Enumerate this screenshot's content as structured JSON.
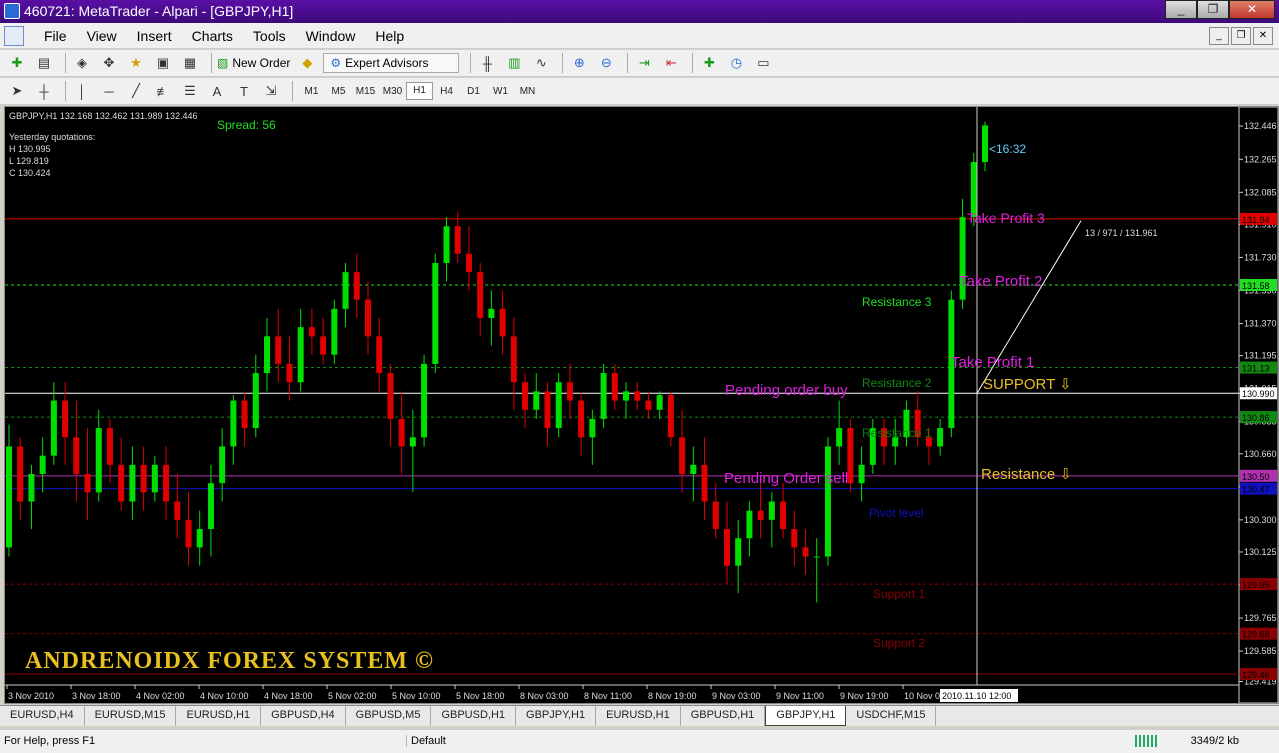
{
  "window": {
    "title": "460721: MetaTrader - Alpari - [GBPJPY,H1]",
    "controls": [
      "_",
      "❐",
      "✕"
    ]
  },
  "menu": [
    "File",
    "View",
    "Insert",
    "Charts",
    "Tools",
    "Window",
    "Help"
  ],
  "toolbar": {
    "new_order": "New Order",
    "expert_advisors": "Expert Advisors"
  },
  "timeframes": [
    "M1",
    "M5",
    "M15",
    "M30",
    "H1",
    "H4",
    "D1",
    "W1",
    "MN"
  ],
  "active_timeframe": "H1",
  "chart": {
    "symbol_info": "GBPJPY,H1  132.168 132.462 131.989 132.446",
    "spread": "Spread: 56",
    "yesterday_label": "Yesterday quotations:",
    "yesterday": [
      "H 130.995",
      "L 129.819",
      "C 130.424"
    ],
    "timer": "<16:32",
    "trendline_label": "13 / 971 / 131.961",
    "watermark": "ANDRENOIDX FOREX SYSTEM    ©",
    "crosshair_time": "2010.11.10 12:00",
    "colors": {
      "bull": "#00e000",
      "bear": "#e00000",
      "resistance": "#22dd22",
      "support": "#8b0000",
      "pivot": "#1010c0",
      "magenta": "#e020e0",
      "gold": "#e8c020"
    }
  },
  "chart_data": {
    "type": "candlestick",
    "symbol": "GBPJPY",
    "timeframe": "H1",
    "y_ticks": [
      "132.446",
      "132.265",
      "132.085",
      "131.910",
      "131.730",
      "131.550",
      "131.370",
      "131.195",
      "131.015",
      "130.990",
      "130.835",
      "130.660",
      "130.480",
      "130.300",
      "130.125",
      "129.945",
      "129.765",
      "129.585",
      "129.419"
    ],
    "x_ticks": [
      "3 Nov 2010",
      "3 Nov 18:00",
      "4 Nov 02:00",
      "4 Nov 10:00",
      "4 Nov 18:00",
      "5 Nov 02:00",
      "5 Nov 10:00",
      "5 Nov 18:00",
      "8 Nov 03:00",
      "8 Nov 11:00",
      "8 Nov 19:00",
      "9 Nov 03:00",
      "9 Nov 11:00",
      "9 Nov 19:00",
      "10 Nov 0"
    ],
    "ylim": [
      129.4,
      132.55
    ],
    "levels": [
      {
        "name": "Take Profit 3",
        "price": 131.94,
        "price_label": "131.94",
        "color": "#e00000",
        "label_color": "#e020e0"
      },
      {
        "name": "Resistance 3",
        "price": 131.58,
        "price_label": "131.58",
        "color": "#22dd22",
        "label_color": "#22dd22"
      },
      {
        "name": "Resistance 2",
        "price": 131.13,
        "price_label": "131.13",
        "color": "#118811",
        "label_color": "#118811"
      },
      {
        "name": "Resistance 1",
        "price": 130.86,
        "price_label": "130.86",
        "color": "#118811",
        "label_color": "#117711"
      },
      {
        "name": "Pivot level",
        "price": 130.47,
        "price_label": "130.47",
        "color": "#1010c0",
        "label_color": "#1010c0"
      },
      {
        "name": "Support 1",
        "price": 129.95,
        "price_label": "129.95",
        "color": "#8b0000",
        "label_color": "#8b0000"
      },
      {
        "name": "Support 2",
        "price": 129.68,
        "price_label": "129.68",
        "color": "#8b0000",
        "label_color": "#8b0000"
      },
      {
        "name": "",
        "price": 129.46,
        "price_label": "129.46",
        "color": "#8b0000",
        "label_color": "#8b0000"
      },
      {
        "name": "Pending order buy",
        "price": 130.99,
        "price_label": "130.990",
        "color": "#ffffff",
        "label_color": "#e020e0"
      },
      {
        "name": "Pending Order sell",
        "price": 130.54,
        "price_label": "130.50",
        "color": "#b030b0",
        "label_color": "#e020e0"
      }
    ],
    "annotations": [
      {
        "text": "Take Profit 2",
        "color": "#e020e0"
      },
      {
        "text": "Take Profit 1",
        "color": "#e020e0"
      },
      {
        "text": "SUPPORT ⇩",
        "color": "#e8c020"
      },
      {
        "text": "Resistance ⇩",
        "color": "#e8c020"
      }
    ],
    "candles": [
      [
        130.15,
        130.82,
        130.1,
        130.7
      ],
      [
        130.7,
        130.75,
        130.3,
        130.4
      ],
      [
        130.4,
        130.6,
        130.25,
        130.55
      ],
      [
        130.55,
        130.75,
        130.45,
        130.65
      ],
      [
        130.65,
        131.05,
        130.6,
        130.95
      ],
      [
        130.95,
        131.05,
        130.6,
        130.75
      ],
      [
        130.75,
        130.95,
        130.4,
        130.55
      ],
      [
        130.55,
        130.8,
        130.3,
        130.45
      ],
      [
        130.45,
        130.9,
        130.4,
        130.8
      ],
      [
        130.8,
        130.85,
        130.5,
        130.6
      ],
      [
        130.6,
        130.75,
        130.35,
        130.4
      ],
      [
        130.4,
        130.7,
        130.3,
        130.6
      ],
      [
        130.6,
        130.7,
        130.35,
        130.45
      ],
      [
        130.45,
        130.65,
        130.4,
        130.6
      ],
      [
        130.6,
        130.7,
        130.3,
        130.4
      ],
      [
        130.4,
        130.55,
        130.2,
        130.3
      ],
      [
        130.3,
        130.45,
        130.05,
        130.15
      ],
      [
        130.15,
        130.35,
        130.05,
        130.25
      ],
      [
        130.25,
        130.6,
        130.1,
        130.5
      ],
      [
        130.5,
        130.8,
        130.4,
        130.7
      ],
      [
        130.7,
        130.98,
        130.6,
        130.95
      ],
      [
        130.95,
        131.0,
        130.7,
        130.8
      ],
      [
        130.8,
        131.2,
        130.75,
        131.1
      ],
      [
        131.1,
        131.4,
        131.0,
        131.3
      ],
      [
        131.3,
        131.45,
        131.05,
        131.15
      ],
      [
        131.15,
        131.3,
        130.95,
        131.05
      ],
      [
        131.05,
        131.45,
        131.0,
        131.35
      ],
      [
        131.35,
        131.45,
        131.2,
        131.3
      ],
      [
        131.3,
        131.4,
        131.15,
        131.2
      ],
      [
        131.2,
        131.5,
        131.15,
        131.45
      ],
      [
        131.45,
        131.7,
        131.35,
        131.65
      ],
      [
        131.65,
        131.75,
        131.4,
        131.5
      ],
      [
        131.5,
        131.6,
        131.2,
        131.3
      ],
      [
        131.3,
        131.4,
        131.0,
        131.1
      ],
      [
        131.1,
        131.15,
        130.7,
        130.85
      ],
      [
        130.85,
        131.0,
        130.55,
        130.7
      ],
      [
        130.7,
        130.9,
        130.45,
        130.75
      ],
      [
        130.75,
        131.2,
        130.7,
        131.15
      ],
      [
        131.15,
        131.75,
        131.1,
        131.7
      ],
      [
        131.7,
        131.95,
        131.6,
        131.9
      ],
      [
        131.9,
        131.98,
        131.7,
        131.75
      ],
      [
        131.75,
        131.9,
        131.55,
        131.65
      ],
      [
        131.65,
        131.7,
        131.3,
        131.4
      ],
      [
        131.4,
        131.55,
        131.25,
        131.45
      ],
      [
        131.45,
        131.55,
        131.2,
        131.3
      ],
      [
        131.3,
        131.4,
        130.9,
        131.05
      ],
      [
        131.05,
        131.1,
        130.8,
        130.9
      ],
      [
        130.9,
        131.1,
        130.85,
        131.0
      ],
      [
        131.0,
        131.05,
        130.7,
        130.8
      ],
      [
        130.8,
        131.1,
        130.75,
        131.05
      ],
      [
        131.05,
        131.15,
        130.85,
        130.95
      ],
      [
        130.95,
        131.0,
        130.65,
        130.75
      ],
      [
        130.75,
        130.9,
        130.6,
        130.85
      ],
      [
        130.85,
        131.15,
        130.8,
        131.1
      ],
      [
        131.1,
        131.15,
        130.9,
        130.95
      ],
      [
        130.95,
        131.05,
        130.85,
        131.0
      ],
      [
        131.0,
        131.05,
        130.9,
        130.95
      ],
      [
        130.95,
        131.0,
        130.85,
        130.9
      ],
      [
        130.9,
        131.0,
        130.85,
        130.98
      ],
      [
        130.98,
        131.0,
        130.7,
        130.75
      ],
      [
        130.75,
        130.9,
        130.45,
        130.55
      ],
      [
        130.55,
        130.7,
        130.4,
        130.6
      ],
      [
        130.6,
        130.75,
        130.3,
        130.4
      ],
      [
        130.4,
        130.5,
        130.2,
        130.25
      ],
      [
        130.25,
        130.4,
        129.95,
        130.05
      ],
      [
        130.05,
        130.3,
        129.9,
        130.2
      ],
      [
        130.2,
        130.4,
        130.1,
        130.35
      ],
      [
        130.35,
        130.5,
        130.2,
        130.3
      ],
      [
        130.3,
        130.45,
        130.15,
        130.4
      ],
      [
        130.4,
        130.5,
        130.2,
        130.25
      ],
      [
        130.25,
        130.35,
        130.05,
        130.15
      ],
      [
        130.15,
        130.25,
        130.0,
        130.1
      ],
      [
        130.1,
        130.2,
        129.85,
        130.1
      ],
      [
        130.1,
        130.75,
        130.05,
        130.7
      ],
      [
        130.7,
        130.95,
        130.6,
        130.8
      ],
      [
        130.8,
        130.85,
        130.45,
        130.5
      ],
      [
        130.5,
        130.7,
        130.4,
        130.6
      ],
      [
        130.6,
        130.85,
        130.55,
        130.8
      ],
      [
        130.8,
        130.85,
        130.6,
        130.7
      ],
      [
        130.7,
        130.85,
        130.6,
        130.75
      ],
      [
        130.75,
        130.95,
        130.7,
        130.9
      ],
      [
        130.9,
        131.0,
        130.7,
        130.75
      ],
      [
        130.75,
        130.8,
        130.6,
        130.7
      ],
      [
        130.7,
        130.85,
        130.65,
        130.8
      ],
      [
        130.8,
        131.55,
        130.75,
        131.5
      ],
      [
        131.5,
        132.05,
        131.45,
        131.95
      ],
      [
        131.95,
        132.3,
        131.9,
        132.25
      ],
      [
        132.25,
        132.47,
        132.2,
        132.45
      ]
    ]
  },
  "tabs": [
    "EURUSD,H4",
    "EURUSD,M15",
    "EURUSD,H1",
    "GBPUSD,H4",
    "GBPUSD,M5",
    "GBPUSD,H1",
    "GBPJPY,H1",
    "EURUSD,H1",
    "GBPUSD,H1",
    "GBPJPY,H1",
    "USDCHF,M15"
  ],
  "active_tab": 9,
  "status": {
    "help": "For Help, press F1",
    "profile": "Default",
    "connection": "3349/2 kb"
  }
}
